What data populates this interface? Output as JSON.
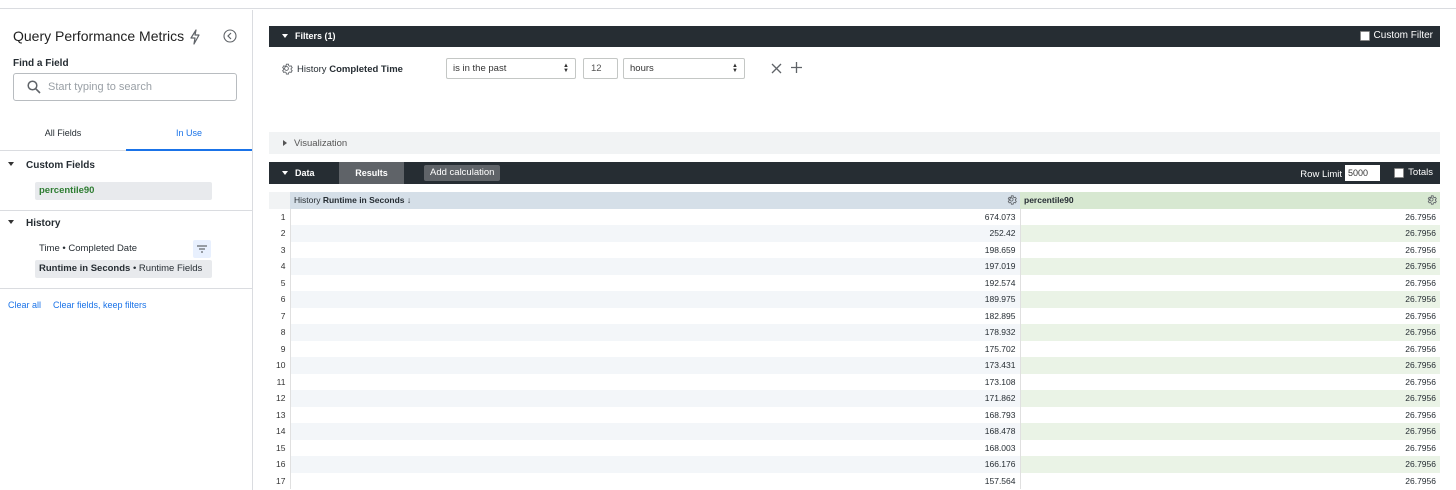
{
  "sidebar": {
    "title": "Query Performance Metrics",
    "find_label": "Find a Field",
    "search_placeholder": "Start typing to search",
    "tabs": [
      "All Fields",
      "In Use"
    ],
    "sections": [
      {
        "label": "Custom Fields",
        "fields": [
          "percentile90"
        ]
      },
      {
        "label": "History",
        "fields": [
          {
            "label": "Time • Completed Date"
          },
          {
            "bold": "Runtime in Seconds",
            "rest": " • Runtime Fields"
          }
        ]
      }
    ],
    "links": [
      "Clear all",
      "Clear fields, keep filters"
    ]
  },
  "filters": {
    "header": "Filters (1)",
    "custom_filter": "Custom Filter",
    "row": {
      "view": "History",
      "field": "Completed Time",
      "operator": "is in the past",
      "value": "12",
      "unit": "hours"
    }
  },
  "visualization": {
    "label": "Visualization"
  },
  "data": {
    "tab_data": "Data",
    "tab_results": "Results",
    "add_calculation": "Add calculation",
    "row_limit_label": "Row Limit",
    "row_limit_value": "5000",
    "totals_label": "Totals",
    "columns": [
      {
        "view": "History",
        "field": "Runtime in Seconds",
        "sort": "↓"
      },
      {
        "field": "percentile90"
      }
    ],
    "rows": [
      [
        "1",
        "674.073",
        "26.7956"
      ],
      [
        "2",
        "252.42",
        "26.7956"
      ],
      [
        "3",
        "198.659",
        "26.7956"
      ],
      [
        "4",
        "197.019",
        "26.7956"
      ],
      [
        "5",
        "192.574",
        "26.7956"
      ],
      [
        "6",
        "189.975",
        "26.7956"
      ],
      [
        "7",
        "182.895",
        "26.7956"
      ],
      [
        "8",
        "178.932",
        "26.7956"
      ],
      [
        "9",
        "175.702",
        "26.7956"
      ],
      [
        "10",
        "173.431",
        "26.7956"
      ],
      [
        "11",
        "173.108",
        "26.7956"
      ],
      [
        "12",
        "171.862",
        "26.7956"
      ],
      [
        "13",
        "168.793",
        "26.7956"
      ],
      [
        "14",
        "168.478",
        "26.7956"
      ],
      [
        "15",
        "168.003",
        "26.7956"
      ],
      [
        "16",
        "166.176",
        "26.7956"
      ],
      [
        "17",
        "157.564",
        "26.7956"
      ]
    ]
  },
  "colors": {
    "header_dark": "#262d33",
    "accent_blue": "#1a73e8",
    "dimension_header": "#d5dfe8",
    "measure_header": "#d7e8d1",
    "measure_text": "#2e7d32"
  },
  "icons": [
    "bolt-icon",
    "collapse-icon",
    "search-icon",
    "gear-icon",
    "close-icon",
    "plus-icon",
    "filter-icon"
  ]
}
